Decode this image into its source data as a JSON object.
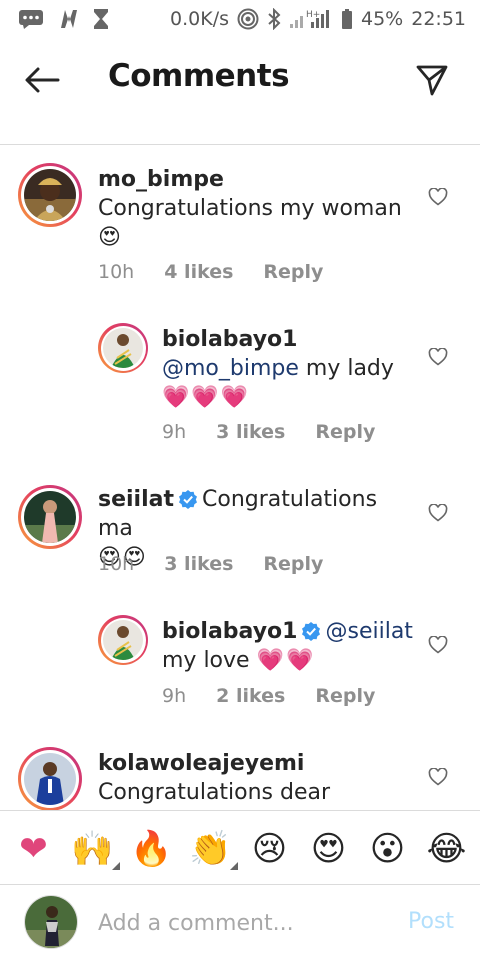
{
  "status_bar": {
    "speed": "0.0K/s",
    "signal_label": "H+",
    "battery": "45%",
    "time": "22:51"
  },
  "header": {
    "title": "Comments",
    "back_icon": "arrow-left-icon",
    "send_icon": "paper-plane-icon"
  },
  "comments": [
    {
      "username": "mo_bimpe",
      "text": "Congratulations my woman",
      "emojis": "😍",
      "time": "10h",
      "likes": "4 likes",
      "reply": "Reply",
      "reply_to": false
    },
    {
      "username": "biolabayo1",
      "mention": "@mo_bimpe",
      "text": " my lady",
      "emojis": "💗💗💗",
      "time": "9h",
      "likes": "3 likes",
      "reply": "Reply",
      "reply_to": true
    },
    {
      "username": "seiilat",
      "verified": true,
      "text": "Congratulations ma",
      "emojis": "😍😍",
      "time": "10h",
      "likes": "3 likes",
      "reply": "Reply",
      "reply_to": false
    },
    {
      "username": "biolabayo1",
      "verified": true,
      "mention": "@seiilat",
      "text": "my love",
      "emojis": "💗💗",
      "time": "9h",
      "likes": "2 likes",
      "reply": "Reply",
      "reply_to": true
    },
    {
      "username": "kolawoleajeyemi",
      "text": "Congratulations dear",
      "reply_to": false
    }
  ],
  "emoji_bar": [
    "❤",
    "🙌",
    "🔥",
    "👏",
    "😢",
    "😍",
    "😮",
    "😂"
  ],
  "composer": {
    "placeholder": "Add a comment...",
    "post_label": "Post"
  },
  "colors": {
    "accent_blue": "#3897f0",
    "verified_blue": "#3897f0",
    "mention": "#1e3a6e",
    "meta_gray": "#8e8e8e",
    "post_disabled": "#b2dffc",
    "heart_pink": "#e0457b"
  }
}
